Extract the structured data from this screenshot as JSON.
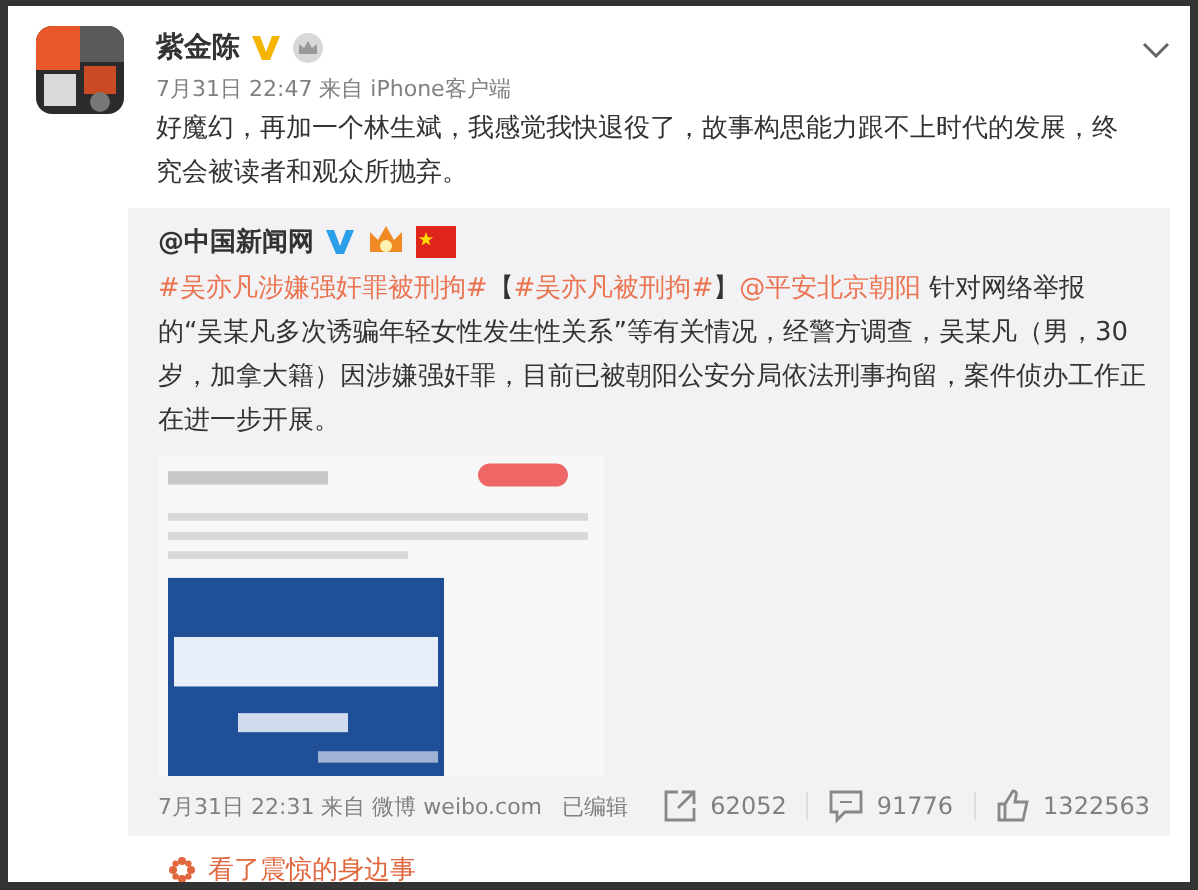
{
  "post": {
    "author": "紫金陈",
    "verified": true,
    "meta": "7月31日 22:47 来自 iPhone客户端",
    "text": "好魔幻，再加一个林生斌，我感觉我快退役了，故事构思能力跟不上时代的发展，终究会被读者和观众所抛弃。"
  },
  "repost": {
    "author": "@中国新闻网",
    "verified": true,
    "segments": [
      {
        "kind": "link",
        "text": "#吴亦凡涉嫌强奸罪被刑拘#"
      },
      {
        "kind": "text",
        "text": "【"
      },
      {
        "kind": "link",
        "text": "#吴亦凡被刑拘#"
      },
      {
        "kind": "text",
        "text": "】"
      },
      {
        "kind": "link",
        "text": "@平安北京朝阳"
      },
      {
        "kind": "text",
        "text": " 针对网络举报的“吴某凡多次诱骗年轻女性发生性关系”等有关情况，经警方调查，吴某凡（男，30岁，加拿大籍）因涉嫌强奸罪，目前已被朝阳公安分局依法刑事拘留，案件侦办工作正在进一步开展。"
      }
    ],
    "meta": "7月31日 22:31 来自 微博 weibo.com",
    "edited": "已编辑",
    "stats": [
      {
        "kind": "repost",
        "count": "62052"
      },
      {
        "kind": "comment",
        "count": "91776"
      },
      {
        "kind": "like",
        "count": "1322563"
      }
    ]
  },
  "footer_link": "看了震惊的身边事"
}
